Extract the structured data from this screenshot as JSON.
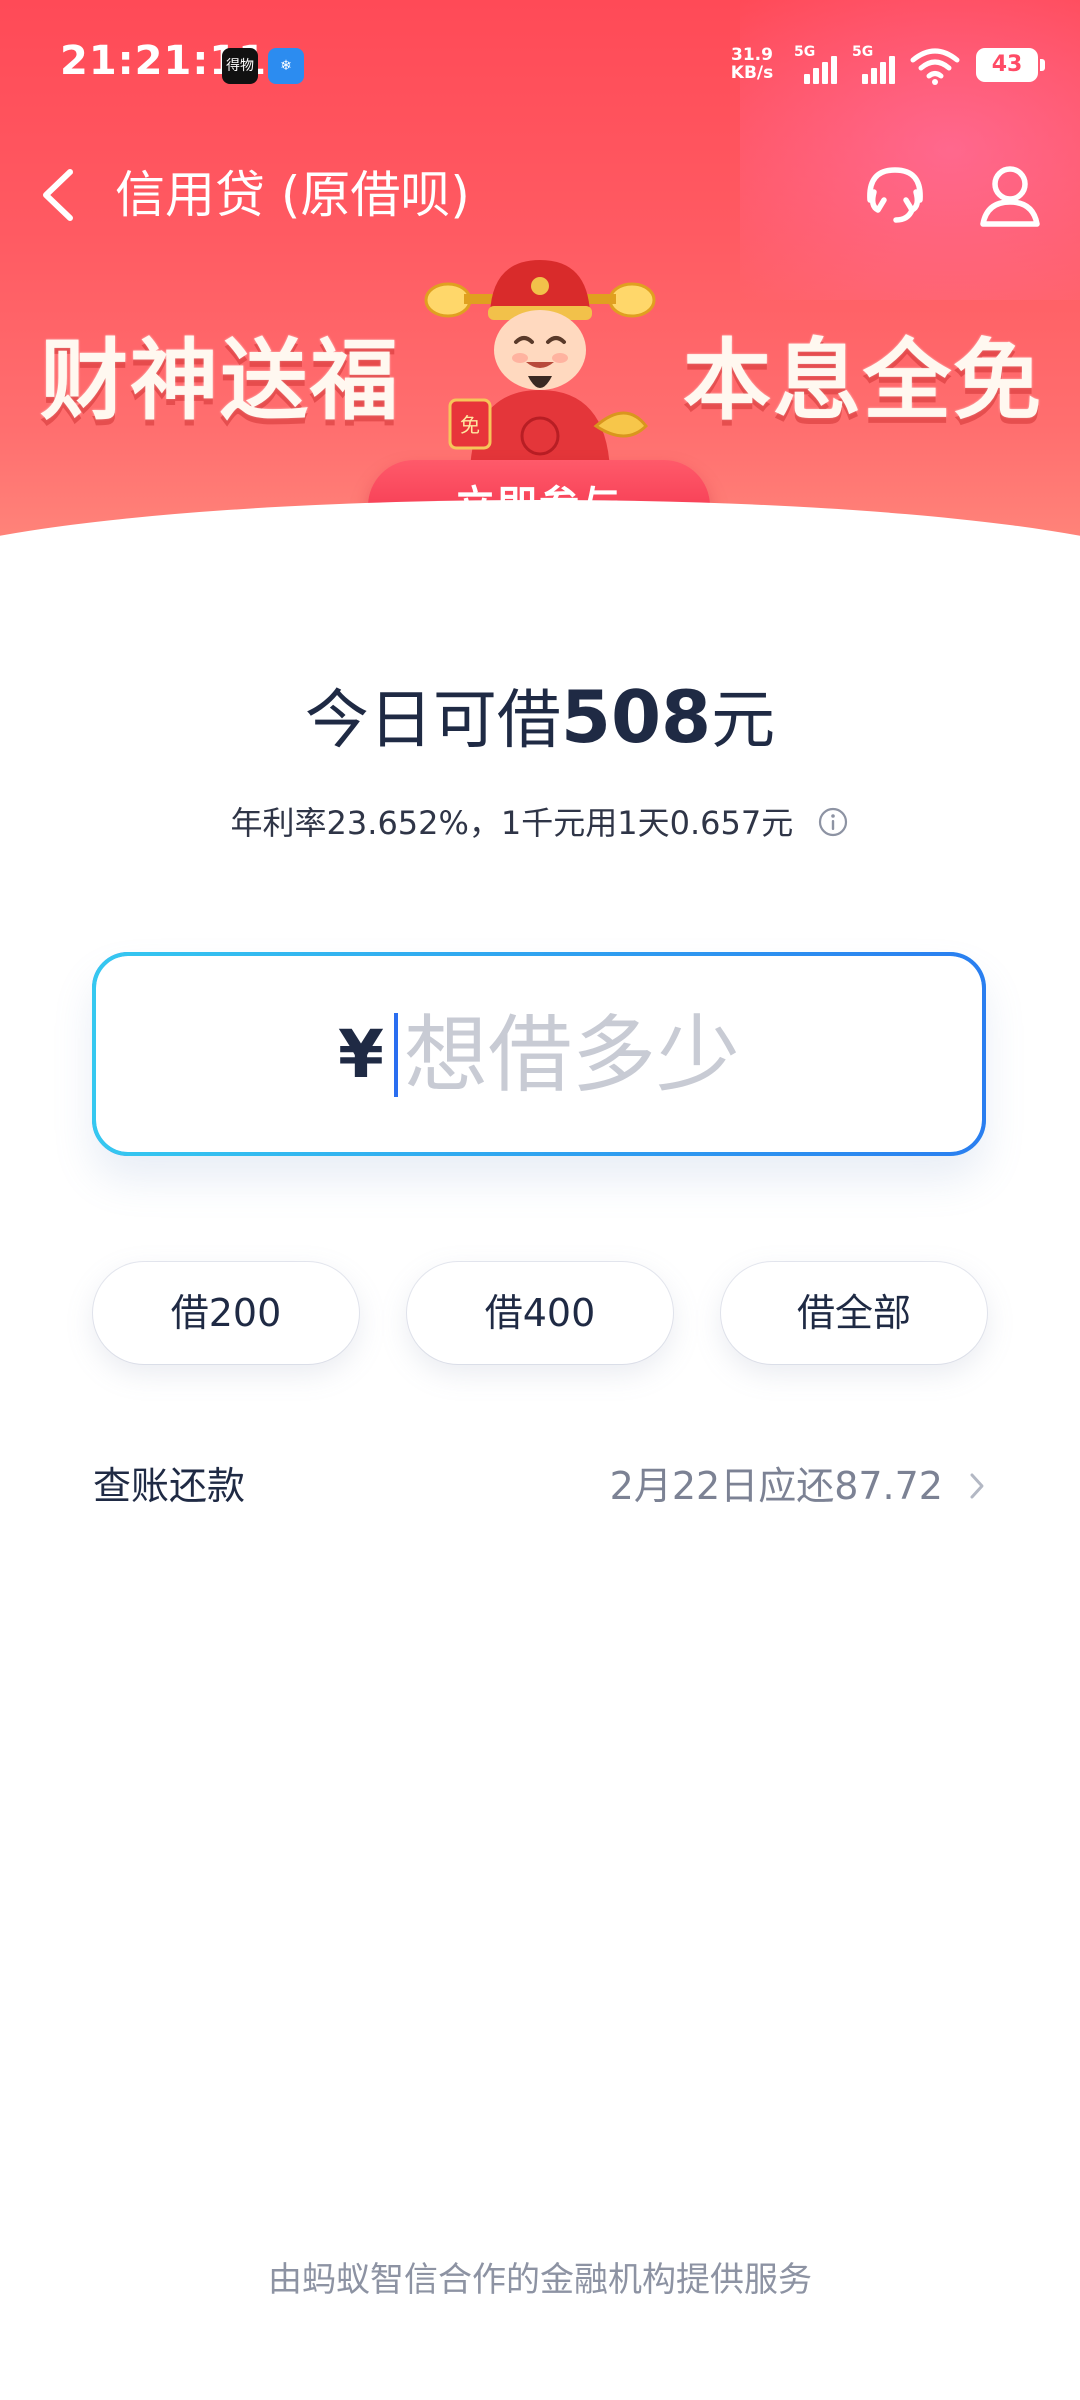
{
  "status_bar": {
    "time": "21:21:11",
    "app_icon_1": "得物",
    "app_icon_2": "❄",
    "net_speed_value": "31.9",
    "net_speed_unit": "KB/s",
    "signal_1_label": "5G",
    "signal_2_label": "5G",
    "battery": "43"
  },
  "nav": {
    "title": "信用贷 (原借呗)",
    "icons": [
      "chevron-left-icon",
      "headset-icon",
      "user-icon"
    ]
  },
  "promo": {
    "left_text": "财神送福",
    "right_text": "本息全免",
    "cta_label": "立即参与",
    "mascot_badge": "免"
  },
  "quota": {
    "prefix": "今日可借",
    "amount": "508",
    "unit": "元"
  },
  "rate_text": "年利率23.652%，1千元用1天0.657元",
  "input": {
    "currency": "¥",
    "placeholder": "想借多少"
  },
  "quick_amounts": [
    "借200",
    "借400",
    "借全部"
  ],
  "bill": {
    "label": "查账还款",
    "due": "2月22日应还87.72"
  },
  "footer": "由蚂蚁智信合作的金融机构提供服务",
  "colors": {
    "hero_top": "#ff4a57",
    "accent_blue": "#2a7ef0",
    "cta_red": "#f02a46",
    "text_dark": "#1f2a44",
    "text_muted": "#8d93a3"
  }
}
